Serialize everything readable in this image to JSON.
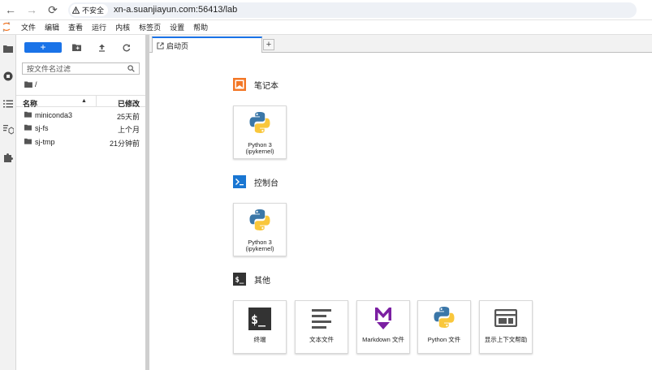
{
  "browser": {
    "security": "不安全",
    "url": "xn-a.suanjiayun.com:56413/lab"
  },
  "menu": [
    "文件",
    "编辑",
    "查看",
    "运行",
    "内核",
    "标签页",
    "设置",
    "帮助"
  ],
  "filebrowser": {
    "filter_placeholder": "按文件名过滤",
    "path": "/",
    "col_name": "名称",
    "col_modified": "已修改",
    "files": [
      {
        "name": "miniconda3",
        "modified": "25天前"
      },
      {
        "name": "sj-fs",
        "modified": "上个月"
      },
      {
        "name": "sj-tmp",
        "modified": "21分钟前"
      }
    ]
  },
  "tab": {
    "label": "启动页"
  },
  "launcher": {
    "notebook": {
      "title": "笔记本",
      "cards": [
        {
          "l1": "Python 3",
          "l2": "(ipykernel)"
        }
      ]
    },
    "console": {
      "title": "控制台",
      "cards": [
        {
          "l1": "Python 3",
          "l2": "(ipykernel)"
        }
      ]
    },
    "other": {
      "title": "其他",
      "cards": [
        {
          "label": "终端"
        },
        {
          "label": "文本文件"
        },
        {
          "label": "Markdown 文件"
        },
        {
          "label": "Python 文件"
        },
        {
          "label": "显示上下文帮助"
        }
      ]
    }
  },
  "colors": {
    "accent": "#1a73e8",
    "notebook": "#f37726",
    "console": "#1976d2",
    "markdown": "#7b1fa2"
  }
}
